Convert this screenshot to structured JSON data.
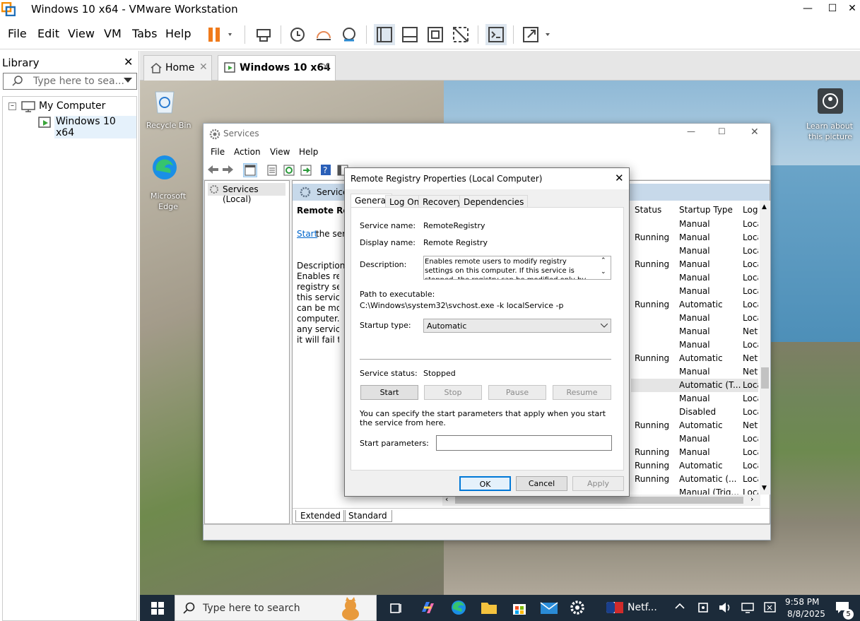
{
  "app": {
    "title": "Windows 10 x64 - VMware Workstation"
  },
  "menu": [
    "File",
    "Edit",
    "View",
    "VM",
    "Tabs",
    "Help"
  ],
  "library": {
    "title": "Library",
    "search_placeholder": "Type here to sea...",
    "tree": [
      {
        "label": "My Computer"
      },
      {
        "label": "Windows 10 x64"
      }
    ]
  },
  "vm_tabs": [
    {
      "label": "Home"
    },
    {
      "label": "Windows 10 x64"
    }
  ],
  "desktop": {
    "icons": [
      {
        "label": "Recycle Bin"
      },
      {
        "label": "Microsoft Edge"
      }
    ],
    "learn_line1": "Learn about",
    "learn_line2": "this picture"
  },
  "services": {
    "title": "Services",
    "menu": [
      "File",
      "Action",
      "View",
      "Help"
    ],
    "tree_item": "Services (Local)",
    "header_title": "Service",
    "detail_title": "Remote Reg",
    "detail_start_link": "Start",
    "detail_start_rest": " the serv",
    "detail_desc_label": "Description:",
    "detail_desc_lines": [
      "Enables remo",
      "registry settin",
      "this service is",
      "can be modifi",
      "computer. If",
      "any services t",
      "it will fail to s"
    ],
    "columns": {
      "status": "Status",
      "startup": "Startup Type",
      "log": "Log"
    },
    "rows": [
      {
        "status": "",
        "startup": "Manual",
        "log": "Loca"
      },
      {
        "status": "Running",
        "startup": "Manual",
        "log": "Loca"
      },
      {
        "status": "",
        "startup": "Manual",
        "log": "Loca"
      },
      {
        "status": "Running",
        "startup": "Manual",
        "log": "Loca"
      },
      {
        "status": "",
        "startup": "Manual",
        "log": "Loca"
      },
      {
        "status": "",
        "startup": "Manual",
        "log": "Loca"
      },
      {
        "status": "Running",
        "startup": "Automatic",
        "log": "Loca"
      },
      {
        "status": "",
        "startup": "Manual",
        "log": "Loca"
      },
      {
        "status": "",
        "startup": "Manual",
        "log": "Netv"
      },
      {
        "status": "",
        "startup": "Manual",
        "log": "Loca"
      },
      {
        "status": "Running",
        "startup": "Automatic",
        "log": "Netv"
      },
      {
        "status": "",
        "startup": "Manual",
        "log": "Netv"
      },
      {
        "status": "",
        "startup": "Automatic (T...",
        "log": "Loca"
      },
      {
        "status": "",
        "startup": "Manual",
        "log": "Loca"
      },
      {
        "status": "",
        "startup": "Disabled",
        "log": "Loca"
      },
      {
        "status": "Running",
        "startup": "Automatic",
        "log": "Netv"
      },
      {
        "status": "",
        "startup": "Manual",
        "log": "Loca"
      },
      {
        "status": "Running",
        "startup": "Manual",
        "log": "Loca"
      },
      {
        "status": "Running",
        "startup": "Automatic",
        "log": "Loca"
      },
      {
        "status": "Running",
        "startup": "Automatic (...",
        "log": "Loca"
      },
      {
        "status": "",
        "startup": "Manual (Trig...",
        "log": "Loca"
      }
    ],
    "bottom_tabs": [
      "Extended",
      "Standard"
    ]
  },
  "dialog": {
    "title": "Remote Registry Properties (Local Computer)",
    "tabs": [
      "General",
      "Log On",
      "Recovery",
      "Dependencies"
    ],
    "service_name_label": "Service name:",
    "service_name": "RemoteRegistry",
    "display_name_label": "Display name:",
    "display_name": "Remote Registry",
    "description_label": "Description:",
    "description": "Enables remote users to modify registry settings on this computer. If this service is stopped, the registry can be modified only by users on this computer. If",
    "path_label": "Path to executable:",
    "path": "C:\\Windows\\system32\\svchost.exe -k localService -p",
    "startup_type_label": "Startup type:",
    "startup_type": "Automatic",
    "service_status_label": "Service status:",
    "service_status": "Stopped",
    "buttons": {
      "start": "Start",
      "stop": "Stop",
      "pause": "Pause",
      "resume": "Resume",
      "ok": "OK",
      "cancel": "Cancel",
      "apply": "Apply"
    },
    "hint": "You can specify the start parameters that apply when you start the service from here.",
    "start_params_label": "Start parameters:"
  },
  "taskbar": {
    "search_placeholder": "Type here to search",
    "netflix": "Netf...",
    "time": "9:58 PM",
    "date": "8/8/2025",
    "notif_count": "5"
  },
  "colors": {
    "accent": "#0078d7",
    "pause": "#f07a1b",
    "taskbar": "#1c2b3a"
  }
}
